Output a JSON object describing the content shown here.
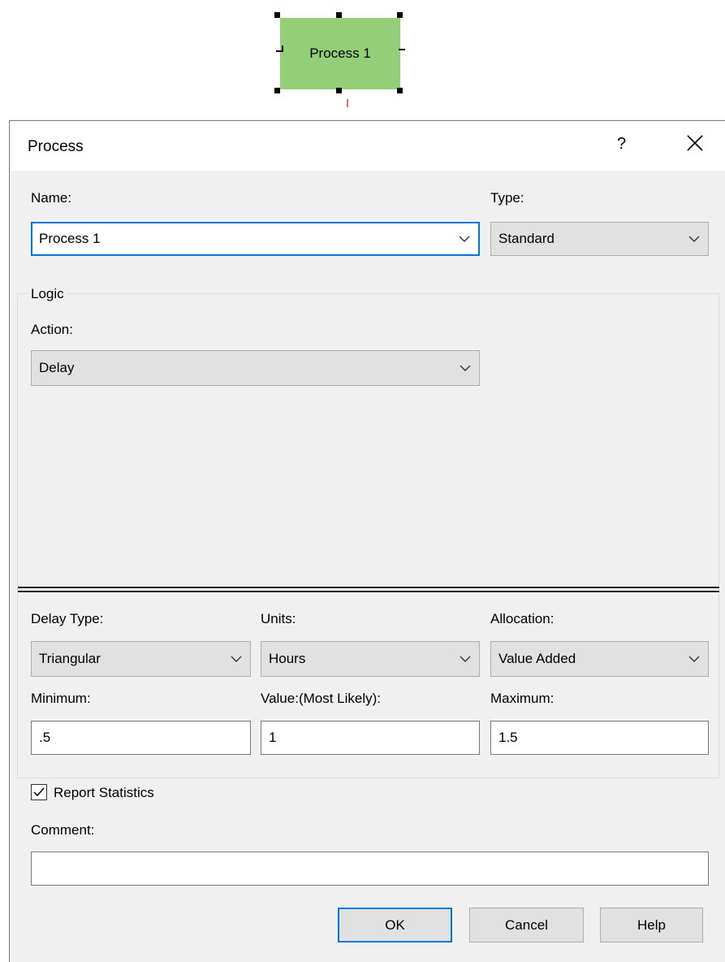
{
  "diagram": {
    "shape_label": "Process 1"
  },
  "dialog": {
    "title": "Process",
    "help_glyph": "?",
    "close_glyph": "×",
    "name": {
      "label": "Name:",
      "value": "Process 1"
    },
    "type": {
      "label": "Type:",
      "value": "Standard"
    },
    "logic": {
      "group_label": "Logic",
      "action": {
        "label": "Action:",
        "value": "Delay"
      }
    },
    "delay_type": {
      "label": "Delay Type:",
      "value": "Triangular"
    },
    "units": {
      "label": "Units:",
      "value": "Hours"
    },
    "allocation": {
      "label": "Allocation:",
      "value": "Value Added"
    },
    "minimum": {
      "label": "Minimum:",
      "value": ".5"
    },
    "most_likely": {
      "label": "Value:(Most Likely):",
      "value": "1"
    },
    "maximum": {
      "label": "Maximum:",
      "value": "1.5"
    },
    "report_statistics": {
      "label": "Report Statistics",
      "checked": true
    },
    "comment": {
      "label": "Comment:",
      "value": ""
    },
    "buttons": {
      "ok": "OK",
      "cancel": "Cancel",
      "help": "Help"
    }
  },
  "colors": {
    "shape_fill": "#92cf78",
    "focus_border": "#0078d7",
    "dialog_bg": "#f0f0f0"
  }
}
